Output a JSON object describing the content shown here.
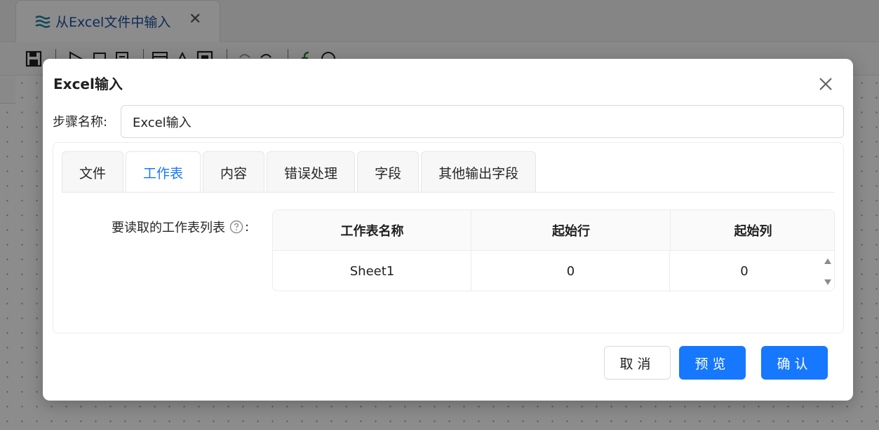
{
  "background_tab": {
    "title": "从Excel文件中输入",
    "icon": "excel-input-icon",
    "close_icon": "close-icon"
  },
  "toolbar": {
    "icons": [
      "save-icon",
      "run-icon",
      "stop-icon",
      "debug-icon",
      "preview-icon",
      "layout-icon",
      "grid-icon",
      "undo-icon",
      "redo-icon",
      "formula-icon",
      "help-icon"
    ]
  },
  "dialog": {
    "title": "Excel输入",
    "close_icon": "close-icon",
    "step_name_label": "步骤名称:",
    "step_name_value": "Excel输入",
    "tabs": [
      {
        "label": "文件",
        "active": false
      },
      {
        "label": "工作表",
        "active": true
      },
      {
        "label": "内容",
        "active": false
      },
      {
        "label": "错误处理",
        "active": false
      },
      {
        "label": "字段",
        "active": false
      },
      {
        "label": "其他输出字段",
        "active": false
      }
    ],
    "sheets_label": "要读取的工作表列表",
    "sheets_colon": ":",
    "sheet_table": {
      "headers": [
        "工作表名称",
        "起始行",
        "起始列"
      ],
      "rows": [
        [
          "Sheet1",
          "0",
          "0"
        ]
      ]
    },
    "buttons": {
      "cancel": "取消",
      "preview": "预览",
      "ok": "确认"
    }
  },
  "colors": {
    "primary": "#1677ff",
    "background_tab_text": "#1a4fa0",
    "overlay": "rgba(0,0,0,0.45)"
  }
}
